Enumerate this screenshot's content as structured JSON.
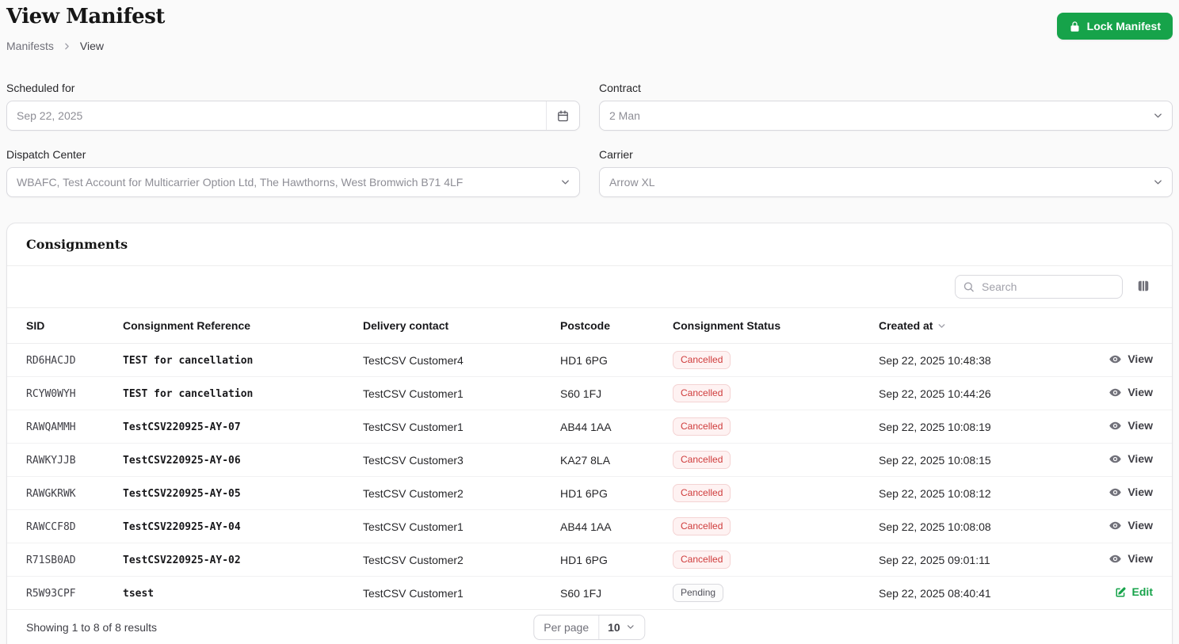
{
  "colors": {
    "accent_green": "#16a34a",
    "danger_text": "#cf3b3b",
    "danger_bg": "#fef2f2"
  },
  "icons": [
    "lock-icon",
    "chevron-right-icon",
    "calendar-icon",
    "chevron-down-icon",
    "search-icon",
    "columns-icon",
    "sort-chevron-icon",
    "eye-icon",
    "edit-pencil-icon"
  ],
  "header": {
    "title": "View Manifest",
    "breadcrumb": [
      "Manifests",
      "View"
    ],
    "lock_button_label": "Lock Manifest"
  },
  "form": {
    "fields": [
      {
        "label": "Scheduled for",
        "value": "Sep 22, 2025",
        "type": "date"
      },
      {
        "label": "Contract",
        "value": "2 Man",
        "type": "select"
      },
      {
        "label": "Dispatch Center",
        "value": "WBAFC, Test Account for Multicarrier Option Ltd, The Hawthorns, West Bromwich B71 4LF",
        "type": "select"
      },
      {
        "label": "Carrier",
        "value": "Arrow XL",
        "type": "select"
      }
    ]
  },
  "consignments": {
    "title": "Consignments",
    "search_placeholder": "Search",
    "columns": [
      "SID",
      "Consignment Reference",
      "Delivery contact",
      "Postcode",
      "Consignment Status",
      "Created at"
    ],
    "rows": [
      {
        "sid": "RD6HACJD",
        "reference": "TEST for cancellation",
        "contact": "TestCSV Customer4",
        "postcode": "HD1 6PG",
        "status": "Cancelled",
        "status_variant": "danger",
        "created_at": "Sep 22, 2025 10:48:38",
        "action": "View",
        "action_variant": "view"
      },
      {
        "sid": "RCYW0WYH",
        "reference": "TEST for cancellation",
        "contact": "TestCSV Customer1",
        "postcode": "S60 1FJ",
        "status": "Cancelled",
        "status_variant": "danger",
        "created_at": "Sep 22, 2025 10:44:26",
        "action": "View",
        "action_variant": "view"
      },
      {
        "sid": "RAWQAMMH",
        "reference": "TestCSV220925-AY-07",
        "contact": "TestCSV Customer1",
        "postcode": "AB44 1AA",
        "status": "Cancelled",
        "status_variant": "danger",
        "created_at": "Sep 22, 2025 10:08:19",
        "action": "View",
        "action_variant": "view"
      },
      {
        "sid": "RAWKYJJB",
        "reference": "TestCSV220925-AY-06",
        "contact": "TestCSV Customer3",
        "postcode": "KA27 8LA",
        "status": "Cancelled",
        "status_variant": "danger",
        "created_at": "Sep 22, 2025 10:08:15",
        "action": "View",
        "action_variant": "view"
      },
      {
        "sid": "RAWGKRWK",
        "reference": "TestCSV220925-AY-05",
        "contact": "TestCSV Customer2",
        "postcode": "HD1 6PG",
        "status": "Cancelled",
        "status_variant": "danger",
        "created_at": "Sep 22, 2025 10:08:12",
        "action": "View",
        "action_variant": "view"
      },
      {
        "sid": "RAWCCF8D",
        "reference": "TestCSV220925-AY-04",
        "contact": "TestCSV Customer1",
        "postcode": "AB44 1AA",
        "status": "Cancelled",
        "status_variant": "danger",
        "created_at": "Sep 22, 2025 10:08:08",
        "action": "View",
        "action_variant": "view"
      },
      {
        "sid": "R71SB0AD",
        "reference": "TestCSV220925-AY-02",
        "contact": "TestCSV Customer2",
        "postcode": "HD1 6PG",
        "status": "Cancelled",
        "status_variant": "danger",
        "created_at": "Sep 22, 2025 09:01:11",
        "action": "View",
        "action_variant": "view"
      },
      {
        "sid": "R5W93CPF",
        "reference": "tsest",
        "contact": "TestCSV Customer1",
        "postcode": "S60 1FJ",
        "status": "Pending",
        "status_variant": "neutral",
        "created_at": "Sep 22, 2025 08:40:41",
        "action": "Edit",
        "action_variant": "edit"
      }
    ],
    "footer": {
      "summary": "Showing 1 to 8 of 8 results",
      "per_page_label": "Per page",
      "per_page_value": "10"
    }
  }
}
